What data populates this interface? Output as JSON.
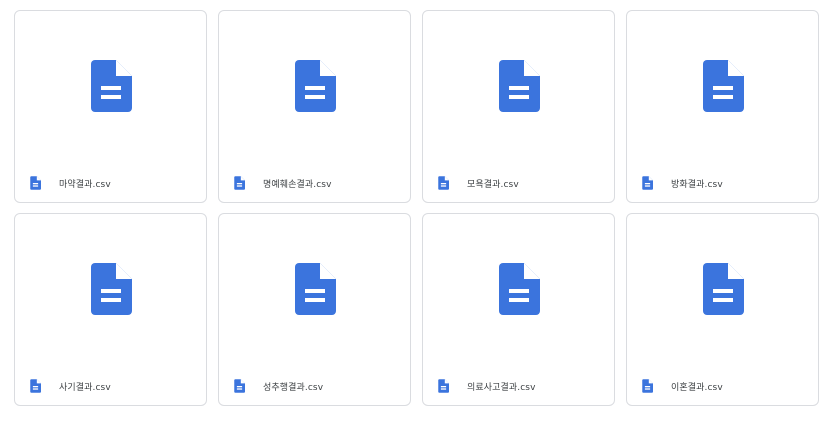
{
  "files": [
    {
      "name": "마약결과.csv",
      "icon": "document-icon"
    },
    {
      "name": "명예훼손결과.csv",
      "icon": "document-icon"
    },
    {
      "name": "모욕결과.csv",
      "icon": "document-icon"
    },
    {
      "name": "방화결과.csv",
      "icon": "document-icon"
    },
    {
      "name": "사기결과.csv",
      "icon": "document-icon"
    },
    {
      "name": "성추행결과.csv",
      "icon": "document-icon"
    },
    {
      "name": "의료사고결과.csv",
      "icon": "document-icon"
    },
    {
      "name": "이혼결과.csv",
      "icon": "document-icon"
    }
  ],
  "colors": {
    "icon_blue": "#3b74dd",
    "border": "#dadce0",
    "text": "#3c4043"
  }
}
